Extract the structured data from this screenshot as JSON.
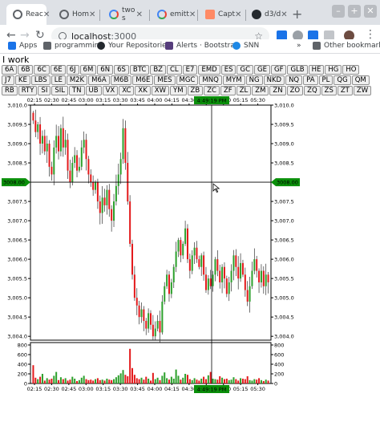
{
  "browser": {
    "tabs": [
      {
        "label": "Reac",
        "icon": "chrome-icon",
        "active": true
      },
      {
        "label": "Hom",
        "icon": "chrome-icon",
        "active": false
      },
      {
        "label": "two s",
        "icon": "google-icon",
        "active": false
      },
      {
        "label": "emitt",
        "icon": "google-icon",
        "active": false
      },
      {
        "label": "Capt",
        "icon": "capture-icon",
        "active": false
      },
      {
        "label": "d3/d",
        "icon": "github-icon",
        "active": false
      }
    ],
    "new_tab": "+",
    "url_host": "localhost",
    "url_port": ":3000",
    "bookmarks": [
      {
        "label": "Apps",
        "icon": "apps-grid-icon"
      },
      {
        "label": "programmin",
        "icon": "folder-icon"
      },
      {
        "label": "Your Repositories",
        "icon": "github-icon"
      },
      {
        "label": "Alerts · Bootstrap",
        "icon": "bootstrap-icon"
      },
      {
        "label": "SNN",
        "icon": "snn-icon"
      }
    ],
    "overflow": "»",
    "other_bookmarks": "Other bookmarks"
  },
  "page": {
    "title": "I work",
    "symbol_rows": [
      [
        "6A",
        "6B",
        "6C",
        "6E",
        "6J",
        "6M",
        "6N",
        "6S",
        "BTC",
        "BZ",
        "CL",
        "E7",
        "EMD",
        "ES",
        "GC",
        "GE",
        "GF",
        "GLB",
        "HE",
        "HG",
        "HO"
      ],
      [
        "J7",
        "KE",
        "LBS",
        "LE",
        "M2K",
        "M6A",
        "M6B",
        "M6E",
        "MES",
        "MGC",
        "MNQ",
        "MYM",
        "NG",
        "NKD",
        "NQ",
        "PA",
        "PL",
        "QG",
        "QM"
      ],
      [
        "RB",
        "RTY",
        "SI",
        "SIL",
        "TN",
        "UB",
        "VX",
        "XC",
        "XK",
        "XW",
        "YM",
        "ZB",
        "ZC",
        "ZF",
        "ZL",
        "ZM",
        "ZN",
        "ZO",
        "ZQ",
        "ZS",
        "ZT",
        "ZW"
      ]
    ]
  },
  "chart_data": {
    "type": "candlestick",
    "x_ticks": [
      "02:15",
      "02:30",
      "02:45",
      "03:00",
      "03:15",
      "03:30",
      "03:45",
      "04:00",
      "04:15",
      "04:30",
      "04:45",
      "05:00",
      "05:15",
      "05:30"
    ],
    "y_ticks": [
      "3,010.0",
      "3,009.5",
      "3,009.0",
      "3,008.5",
      "3,008.0",
      "3,007.5",
      "3,007.0",
      "3,006.5",
      "3,006.0",
      "3,005.5",
      "3,005.0",
      "3,004.5",
      "3,004.0"
    ],
    "ylim": [
      3003.9,
      3010.0
    ],
    "volume_ticks": [
      "800",
      "600",
      "400",
      "200",
      "0"
    ],
    "volume_lim": [
      0,
      800
    ],
    "crosshair": {
      "time_label": "4:49:19 PM",
      "price_label": "3008.00"
    },
    "colors": {
      "up": "#2ca02c",
      "down": "#e31a1c",
      "flat": "#333333",
      "badge": "#0a8f0a"
    },
    "close": [
      3009.6,
      3009.3,
      3009.5,
      3009.0,
      3009.2,
      3008.8,
      3009.0,
      3008.4,
      3008.2,
      3008.9,
      3009.2,
      3008.8,
      3009.4,
      3008.9,
      3009.1,
      3008.3,
      3008.0,
      3008.5,
      3008.7,
      3008.3,
      3008.4,
      3008.9,
      3009.1,
      3008.6,
      3008.2,
      3008.0,
      3007.8,
      3008.0,
      3007.5,
      3007.2,
      3007.6,
      3007.4,
      3007.8,
      3007.3,
      3007.0,
      3007.5,
      3007.9,
      3008.2,
      3008.6,
      3009.4,
      3008.5,
      3007.5,
      3006.4,
      3005.6,
      3005.0,
      3004.8,
      3004.5,
      3004.7,
      3004.4,
      3004.2,
      3004.6,
      3004.3,
      3004.0,
      3004.2,
      3004.4,
      3004.1,
      3004.9,
      3005.3,
      3005.6,
      3005.1,
      3005.4,
      3005.8,
      3006.2,
      3006.5,
      3006.1,
      3006.4,
      3006.8,
      3006.0,
      3005.7,
      3006.1,
      3006.3,
      3006.0,
      3005.8,
      3006.1,
      3005.6,
      3005.2,
      3005.5,
      3005.3,
      3005.6,
      3006.0,
      3005.7,
      3005.4,
      3005.8,
      3005.5,
      3005.1,
      3005.4,
      3005.7,
      3006.1,
      3005.8,
      3005.5,
      3005.9,
      3005.6,
      3005.2,
      3004.9,
      3005.3,
      3005.7,
      3006.0,
      3005.7,
      3005.4,
      3005.7,
      3005.3,
      3005.6,
      3005.4
    ]
  }
}
